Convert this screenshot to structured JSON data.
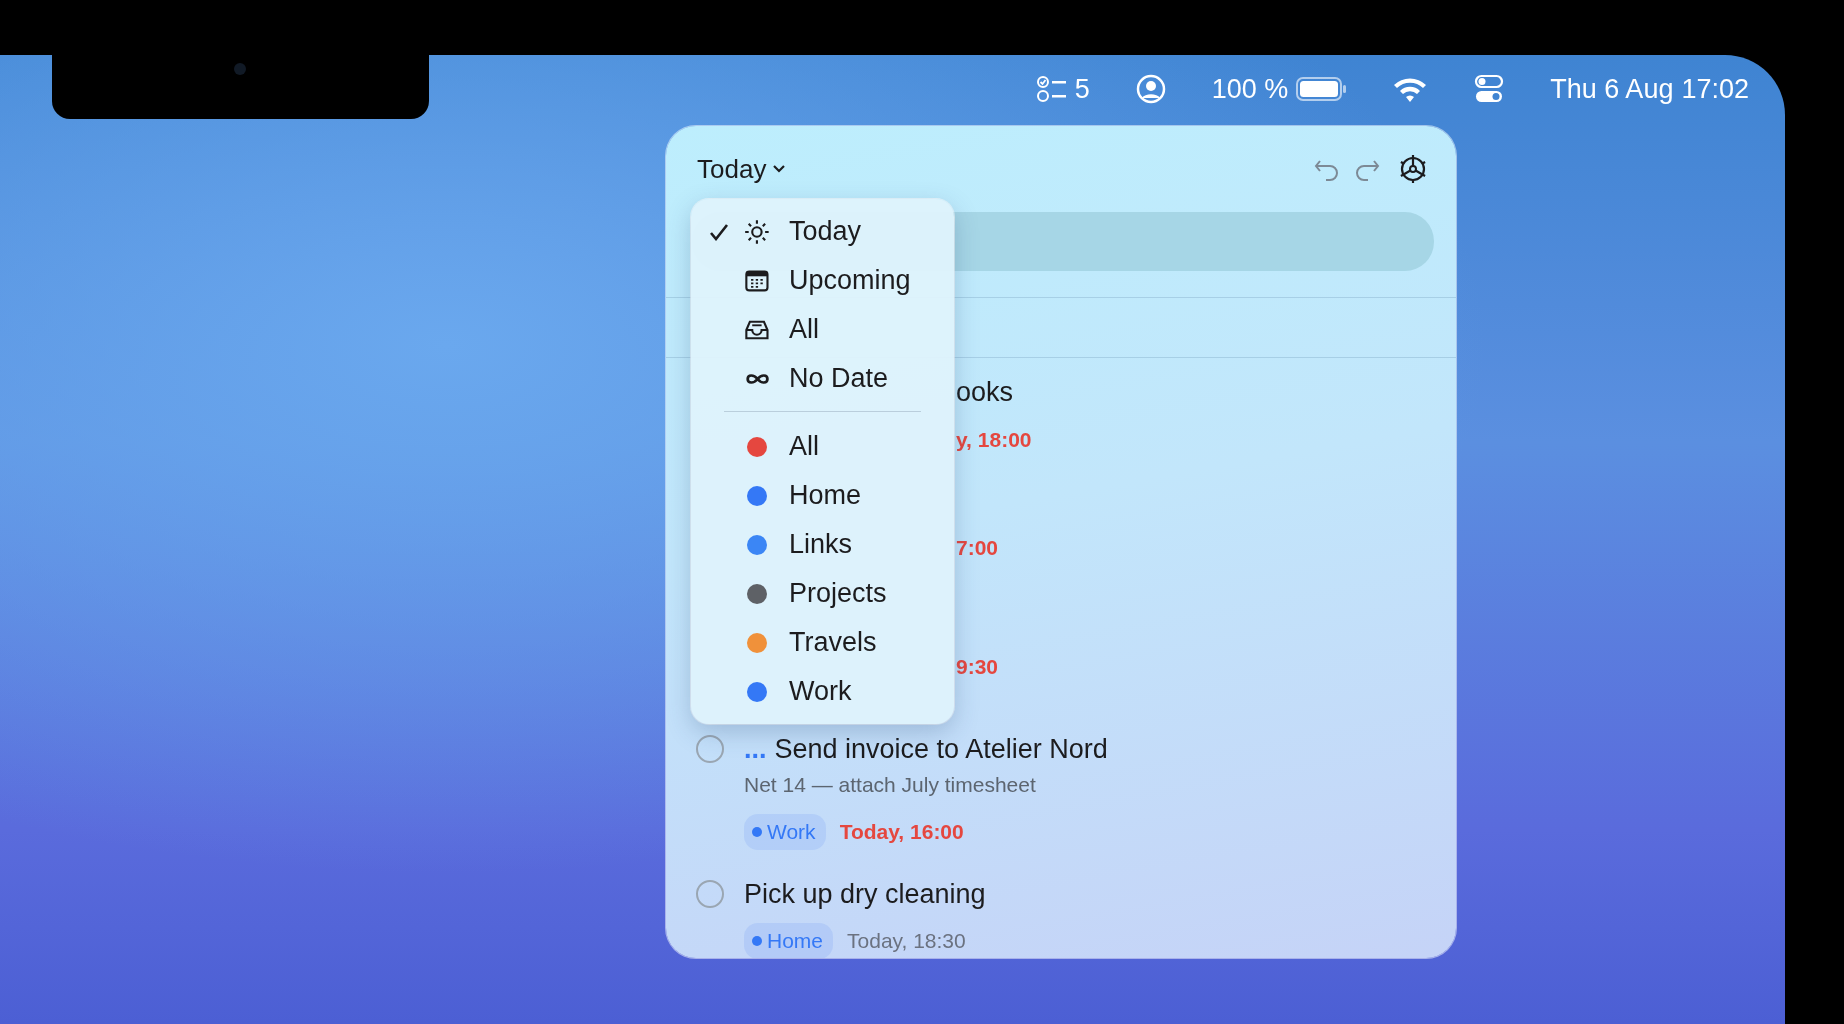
{
  "menu_bar": {
    "reminders_count": "5",
    "battery_percent": "100 %",
    "date": "Thu 6 Aug",
    "time": "17:02"
  },
  "popover": {
    "title": "Today",
    "tasks": [
      {
        "kind": "obscured",
        "title": "ooks",
        "due": "y, 18:00",
        "overdue": true
      },
      {
        "kind": "obscured",
        "due": "7:00",
        "overdue": true
      },
      {
        "kind": "obscured",
        "due": "9:30",
        "overdue": true
      },
      {
        "kind": "full",
        "priority": "...",
        "title": "Send invoice to Atelier Nord",
        "note": "Net 14 — attach July timesheet",
        "tag": {
          "label": "Work",
          "color": "#3478f6"
        },
        "due": "Today, 16:00",
        "overdue": true,
        "done": false
      },
      {
        "kind": "full",
        "title": "Pick up dry cleaning",
        "tag": {
          "label": "Home",
          "color": "#3478f6"
        },
        "due": "Today, 18:30",
        "overdue": false,
        "done": false
      }
    ]
  },
  "view_menu": {
    "views": [
      {
        "kind": "sun",
        "label": "Today",
        "selected": true
      },
      {
        "kind": "calendar",
        "label": "Upcoming",
        "selected": false
      },
      {
        "kind": "tray",
        "label": "All",
        "selected": false
      },
      {
        "kind": "infinity",
        "label": "No Date",
        "selected": false
      }
    ],
    "lists": [
      {
        "label": "All",
        "color": "#e5473f",
        "selected": false
      },
      {
        "label": "Home",
        "color": "#3478f6",
        "selected": false
      },
      {
        "label": "Links",
        "color": "#3b86f5",
        "selected": false
      },
      {
        "label": "Projects",
        "color": "#5e6166",
        "selected": false
      },
      {
        "label": "Travels",
        "color": "#f0913a",
        "selected": false
      },
      {
        "label": "Work",
        "color": "#3478f6",
        "selected": false
      }
    ]
  }
}
